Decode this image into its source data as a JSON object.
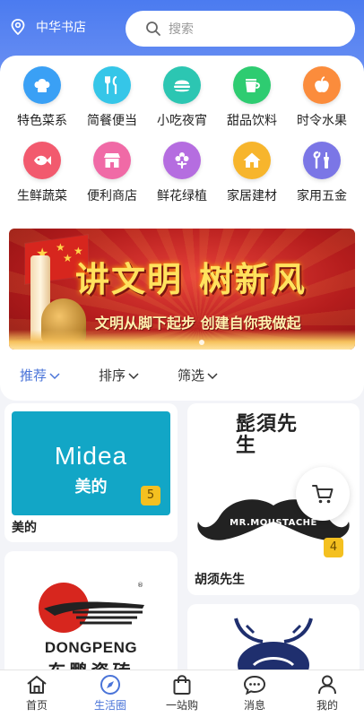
{
  "header": {
    "location": "中华书店",
    "search_placeholder": "搜索"
  },
  "categories": [
    {
      "label": "特色菜系",
      "icon": "chef-hat-icon",
      "color": "#3aa0f5"
    },
    {
      "label": "简餐便当",
      "icon": "fork-knife-icon",
      "color": "#35c6e8"
    },
    {
      "label": "小吃夜宵",
      "icon": "burger-icon",
      "color": "#2cc6b2"
    },
    {
      "label": "甜品饮料",
      "icon": "cup-icon",
      "color": "#2ecc71"
    },
    {
      "label": "时令水果",
      "icon": "apple-icon",
      "color": "#fb8c3c"
    },
    {
      "label": "生鲜蔬菜",
      "icon": "fish-icon",
      "color": "#f25a6e"
    },
    {
      "label": "便利商店",
      "icon": "store-icon",
      "color": "#f06aa6"
    },
    {
      "label": "鲜花绿植",
      "icon": "flower-icon",
      "color": "#b56de0"
    },
    {
      "label": "家居建材",
      "icon": "house-icon",
      "color": "#f7b52c"
    },
    {
      "label": "家用五金",
      "icon": "tools-icon",
      "color": "#7b76e6"
    }
  ],
  "banner": {
    "title_part1": "讲文明",
    "title_part2": "树新风",
    "subtitle": "文明从脚下起步  创建自你我做起"
  },
  "filters": {
    "recommend": "推荐",
    "sort": "排序",
    "filter": "筛选"
  },
  "shops": [
    {
      "name": "美的",
      "logo_text": "Midea",
      "logo_sub": "美的",
      "badge": "5"
    },
    {
      "name": "胡须先生",
      "logo_text": "MR.MOUSTACHE",
      "logo_sub": "髭須先生",
      "badge": "4"
    },
    {
      "name": "",
      "logo_text": "DONGPENG",
      "logo_sub": "东鹏瓷砖",
      "badge": ""
    },
    {
      "name": "",
      "logo_text": "",
      "logo_sub": "",
      "badge": ""
    }
  ],
  "tabbar": [
    {
      "label": "首页",
      "icon": "home-icon"
    },
    {
      "label": "生活圈",
      "icon": "compass-icon"
    },
    {
      "label": "一站购",
      "icon": "shopping-bag-icon"
    },
    {
      "label": "消息",
      "icon": "chat-icon"
    },
    {
      "label": "我的",
      "icon": "user-icon"
    }
  ],
  "colors": {
    "primary": "#4b7bf0",
    "active": "#4a74d8",
    "badge": "#f4c020"
  }
}
